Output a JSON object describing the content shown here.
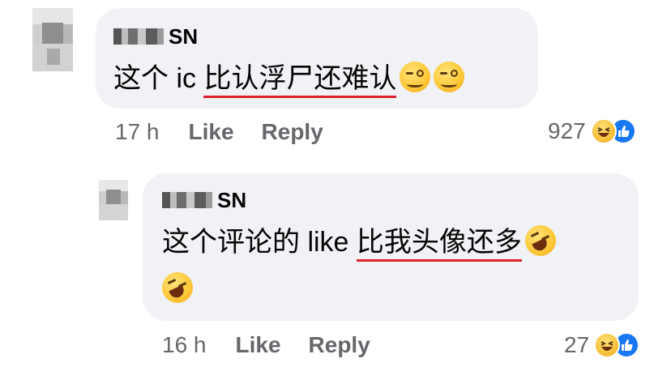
{
  "comments": [
    {
      "author_suffix": "SN",
      "text_before": "这个 ic ",
      "text_underlined": "比认浮尸还难认",
      "emojis": [
        "woozy-face",
        "woozy-face"
      ],
      "time": "17 h",
      "like_label": "Like",
      "reply_label": "Reply",
      "reaction_count": "927",
      "reaction_icons": [
        "haha-icon",
        "like-icon"
      ]
    },
    {
      "author_suffix": "SN",
      "text_before": "这个评论的 like ",
      "text_underlined": "比我头像还多",
      "emojis": [
        "rolling-on-floor-laughing",
        "rolling-on-floor-laughing"
      ],
      "time": "16 h",
      "like_label": "Like",
      "reply_label": "Reply",
      "reaction_count": "27",
      "reaction_icons": [
        "haha-icon",
        "like-icon"
      ]
    }
  ],
  "colors": {
    "bubble_bg": "#f0f2f5",
    "underline": "#e0212b",
    "meta_text": "#65676b",
    "like_blue": "#1877f2"
  }
}
